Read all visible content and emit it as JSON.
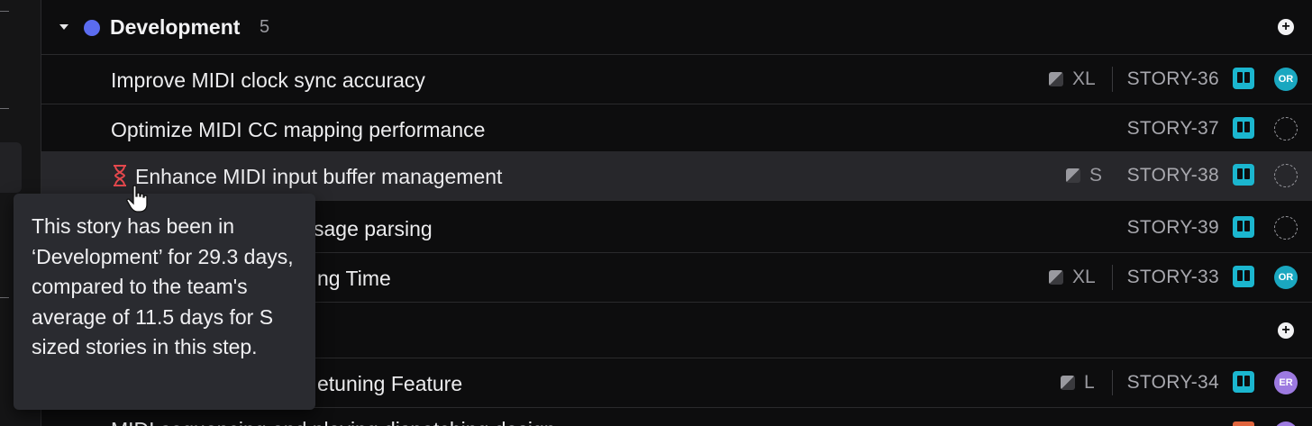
{
  "group_dev": {
    "name": "Development",
    "count": "5",
    "color": "#5b6cf0"
  },
  "rows": [
    {
      "title": "Improve MIDI clock sync accuracy",
      "estimate": "XL",
      "id": "STORY-36",
      "avatar": "OR",
      "avatar_color": "#1aa7c0"
    },
    {
      "title": "Optimize MIDI CC mapping performance",
      "estimate": "",
      "id": "STORY-37",
      "avatar": ""
    },
    {
      "title": "Enhance MIDI input buffer management",
      "estimate": "S",
      "id": "STORY-38",
      "avatar": "",
      "flag": "hourglass-icon"
    },
    {
      "title": "sage parsing",
      "estimate": "",
      "id": "STORY-39",
      "avatar": ""
    },
    {
      "title": "ng Time",
      "estimate": "XL",
      "id": "STORY-33",
      "avatar": "OR",
      "avatar_color": "#1aa7c0"
    },
    {
      "title": "etuning Feature",
      "estimate": "L",
      "id": "STORY-34",
      "avatar": "ER",
      "avatar_color": "#9d7ae0"
    }
  ],
  "tooltip": {
    "text": "This story has been in ‘Development’ for 29.3 days, compared to the team's average of 11.5 days for S sized stories in this step."
  },
  "partial_row_text": "MIDI sequencing and playing dispatching design"
}
